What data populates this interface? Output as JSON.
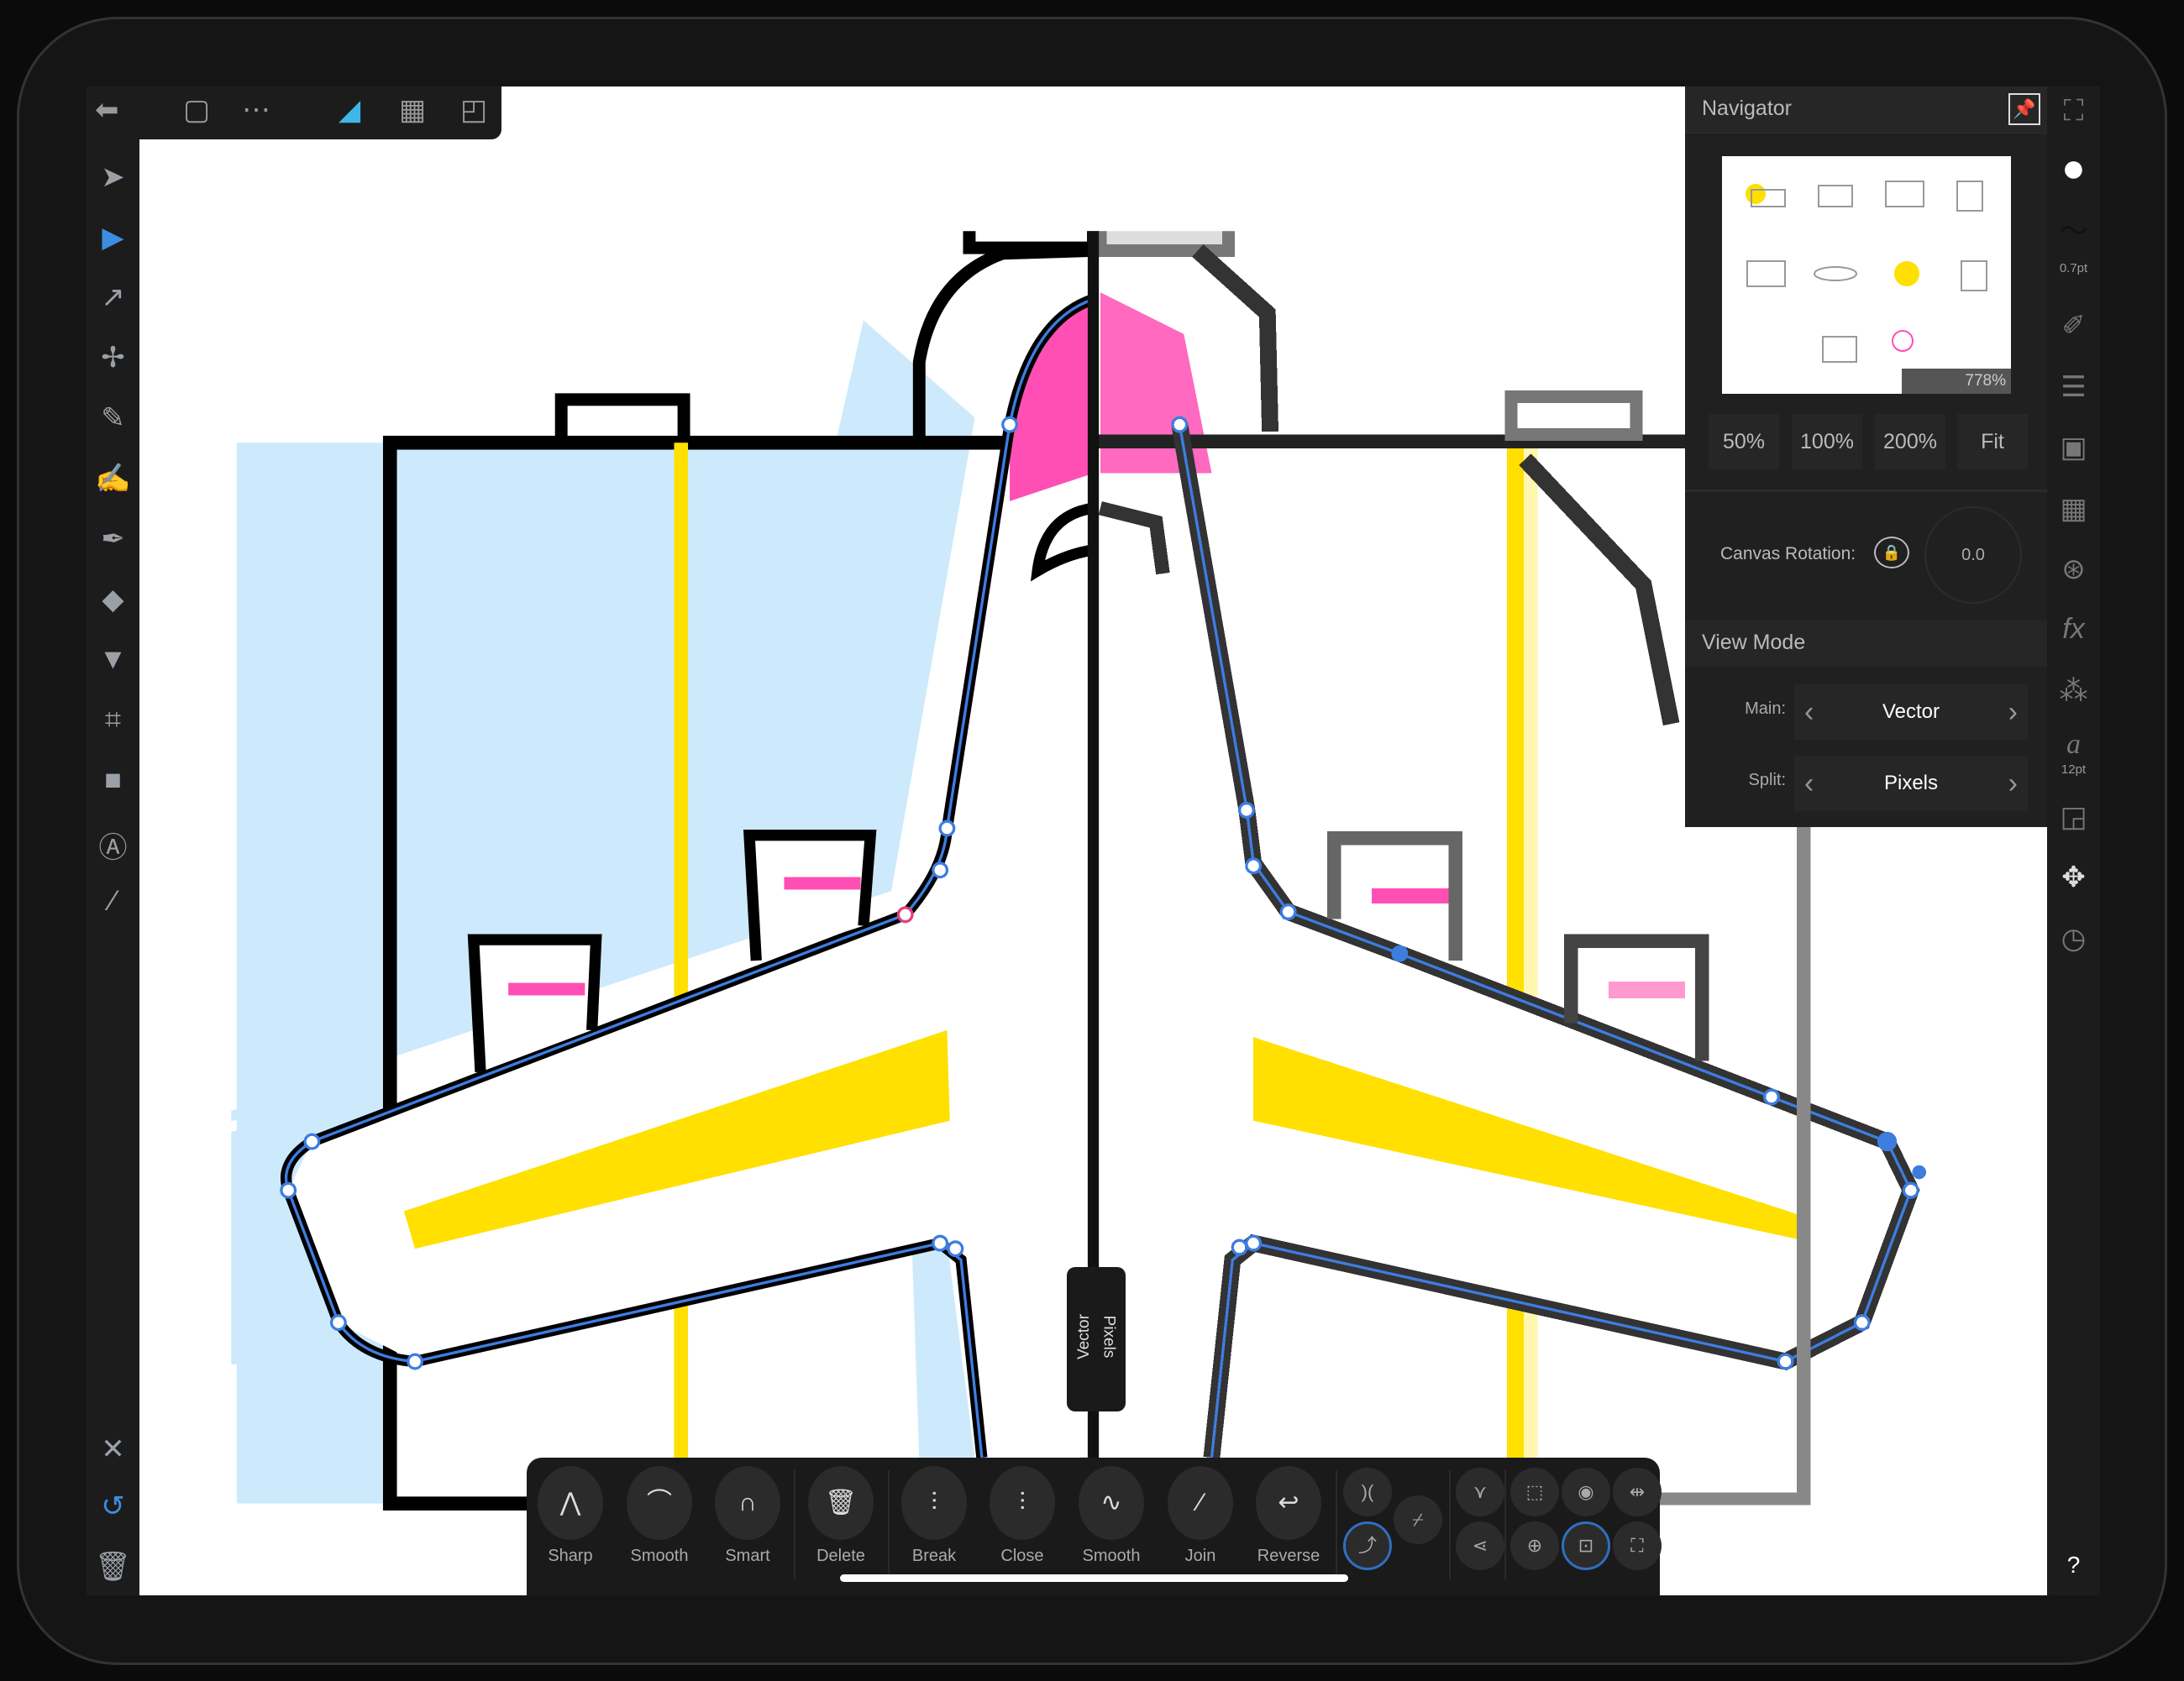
{
  "top_toolbar": {
    "icons": [
      "back-icon",
      "document-icon",
      "more-icon",
      "affinity-designer-persona-icon",
      "pixel-persona-icon",
      "export-persona-icon"
    ]
  },
  "left_toolbar": {
    "tools": [
      "move-tool",
      "node-tool",
      "corner-tool",
      "point-transform-tool",
      "pencil-tool",
      "vector-brush-tool",
      "pen-tool",
      "fill-tool",
      "transparency-tool",
      "crop-tool",
      "rectangle-tool",
      "text-tool",
      "eyedropper-tool"
    ],
    "bottom": [
      "close-icon",
      "undo-history-icon",
      "trash-icon"
    ]
  },
  "navigator": {
    "title": "Navigator",
    "zoom_readout": "778%",
    "zoom_buttons": [
      "50%",
      "100%",
      "200%",
      "Fit"
    ],
    "canvas_rotation_label": "Canvas Rotation:",
    "rotation_value": "0.0",
    "view_mode_title": "View Mode",
    "main_label": "Main:",
    "main_value": "Vector",
    "split_label": "Split:",
    "split_value": "Pixels"
  },
  "right_sidebar": {
    "stroke_width": "0.7pt",
    "font_size": "12pt",
    "help": "?",
    "icons": [
      "fullscreen-icon",
      "color-icon",
      "stroke-icon",
      "brushes-icon",
      "layers-icon",
      "effects-icon",
      "swatches-icon",
      "appearance-icon",
      "fx-icon",
      "styles-icon",
      "text-style-icon",
      "transform-icon",
      "navigator-icon",
      "history-icon"
    ]
  },
  "split_handle": {
    "left": "Vector",
    "right": "Pixels"
  },
  "bottom_toolbar": {
    "convert": [
      "Sharp",
      "Smooth",
      "Smart"
    ],
    "delete": "Delete",
    "actions": [
      "Break",
      "Close",
      "Smooth",
      "Join",
      "Reverse"
    ]
  },
  "colors": {
    "accent": "#3d8de0",
    "pink": "#ff4fb4",
    "yellow": "#ffe000",
    "lightblue": "#cdeafc"
  }
}
